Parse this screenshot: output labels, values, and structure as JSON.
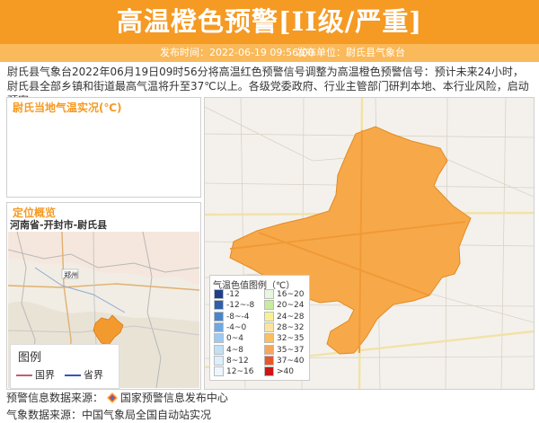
{
  "header": {
    "title": "高温橙色预警[II级/严重]"
  },
  "subbar": {
    "publish_time": "发布时间：2022-06-19 09:56:00",
    "publish_unit": "发布单位：尉氏县气象台"
  },
  "description": "尉氏县气象台2022年06月19日09时56分将高温红色预警信号调整为高温橙色预警信号：预计未来24小时，尉氏县全部乡镇和街道最高气温将升至37℃以上。各级党委政府、行业主管部门研判本地、本行业风险，启动预案。",
  "observation": {
    "title": "尉氏当地气温实况(℃)"
  },
  "location": {
    "title": "定位概览",
    "path": "河南省-开封市-尉氏县",
    "map_label": "郑州",
    "legend": {
      "title": "图例",
      "items": [
        {
          "label": "国界",
          "color": "#c06070"
        },
        {
          "label": "省界",
          "color": "#3355bb"
        }
      ]
    }
  },
  "temp_legend": {
    "title": "气温色值图例（℃）",
    "items": [
      {
        "label": "-12",
        "color": "#1f3f8a"
      },
      {
        "label": "16~20",
        "color": "#e8f6e0"
      },
      {
        "label": "-12~-8",
        "color": "#2f5fa8"
      },
      {
        "label": "20~24",
        "color": "#c6ec9c"
      },
      {
        "label": "-8~-4",
        "color": "#4a85cc"
      },
      {
        "label": "24~28",
        "color": "#f6f294"
      },
      {
        "label": "-4~0",
        "color": "#6ea8e2"
      },
      {
        "label": "28~32",
        "color": "#fde3a0"
      },
      {
        "label": "0~4",
        "color": "#9dcaf0"
      },
      {
        "label": "32~35",
        "color": "#fbbf5e"
      },
      {
        "label": "4~8",
        "color": "#c0e0f6"
      },
      {
        "label": "35~37",
        "color": "#f7a65a"
      },
      {
        "label": "8~12",
        "color": "#dcefff"
      },
      {
        "label": "37~40",
        "color": "#e8572a"
      },
      {
        "label": "12~16",
        "color": "#eef7ff"
      },
      {
        "label": ">40",
        "color": "#cc1515"
      }
    ]
  },
  "footer": {
    "warning_source": "预警信息数据来源：",
    "warning_source_name": "国家预警信息发布中心",
    "weather_source": "气象数据来源：中国气象局全国自动站实况"
  },
  "colors": {
    "accent": "#f59a23",
    "region_fill": "#f7a94a"
  }
}
